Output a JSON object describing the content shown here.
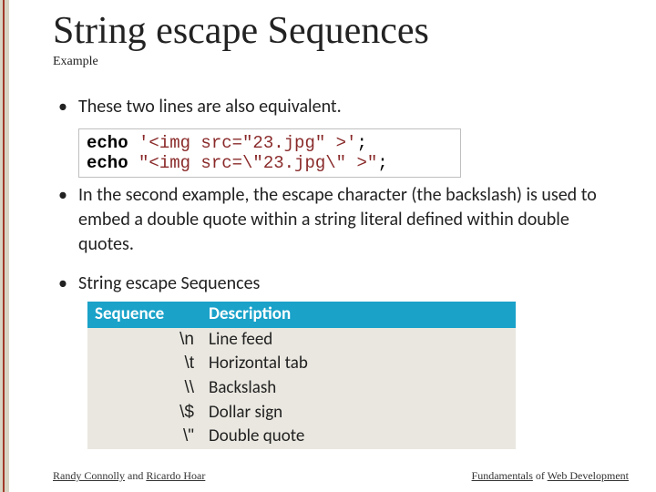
{
  "header": {
    "title": "String escape Sequences",
    "subtitle": "Example"
  },
  "bullets": {
    "first": "These two lines are also equivalent.",
    "second": "In the second example, the escape character (the backslash) is used to embed a double quote within a string literal defined within double quotes.",
    "third": "String escape Sequences"
  },
  "code": {
    "line1": {
      "kw": "echo",
      "sp": " ",
      "str": "'<img src=\"23.jpg\" >'",
      "end": ";"
    },
    "line2": {
      "kw": "echo",
      "sp": " ",
      "str": "\"<img src=\\\"23.jpg\\\" >\"",
      "end": ";"
    }
  },
  "table": {
    "header": {
      "seq": "Sequence",
      "desc": "Description"
    },
    "rows": [
      {
        "seq": "\\n",
        "desc": "Line feed"
      },
      {
        "seq": "\\t",
        "desc": "Horizontal tab"
      },
      {
        "seq": "\\\\",
        "desc": "Backslash"
      },
      {
        "seq": "\\$",
        "desc": "Dollar sign"
      },
      {
        "seq": "\\\"",
        "desc": "Double quote"
      }
    ]
  },
  "footer": {
    "left": {
      "a": "Randy Connolly",
      "mid": " and ",
      "b": "Ricardo Hoar"
    },
    "right": {
      "a": "Fundamentals",
      "mid": " of ",
      "b": "Web Development"
    }
  }
}
